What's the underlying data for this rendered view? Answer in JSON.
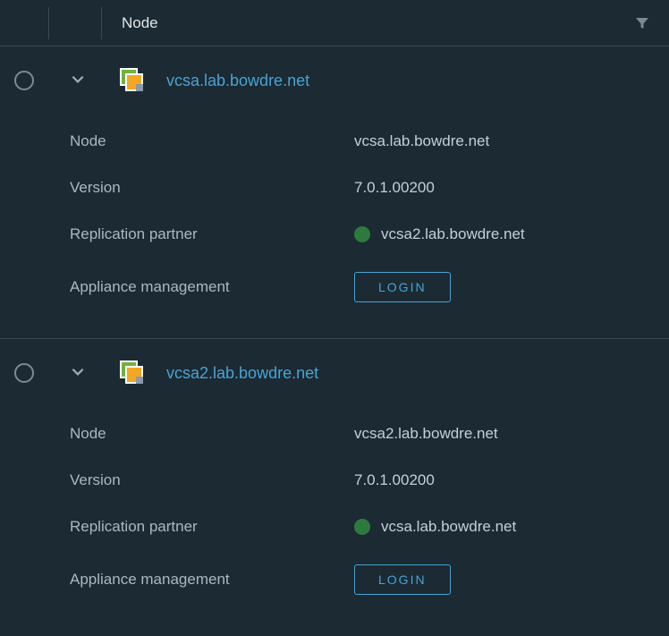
{
  "header": {
    "column_label": "Node"
  },
  "labels": {
    "node": "Node",
    "version": "Version",
    "replication_partner": "Replication partner",
    "appliance_management": "Appliance management",
    "login": "LOGIN"
  },
  "nodes": [
    {
      "name": "vcsa.lab.bowdre.net",
      "node": "vcsa.lab.bowdre.net",
      "version": "7.0.1.00200",
      "replication_partner": "vcsa2.lab.bowdre.net",
      "partner_status": "ok"
    },
    {
      "name": "vcsa2.lab.bowdre.net",
      "node": "vcsa2.lab.bowdre.net",
      "version": "7.0.1.00200",
      "replication_partner": "vcsa.lab.bowdre.net",
      "partner_status": "ok"
    }
  ]
}
